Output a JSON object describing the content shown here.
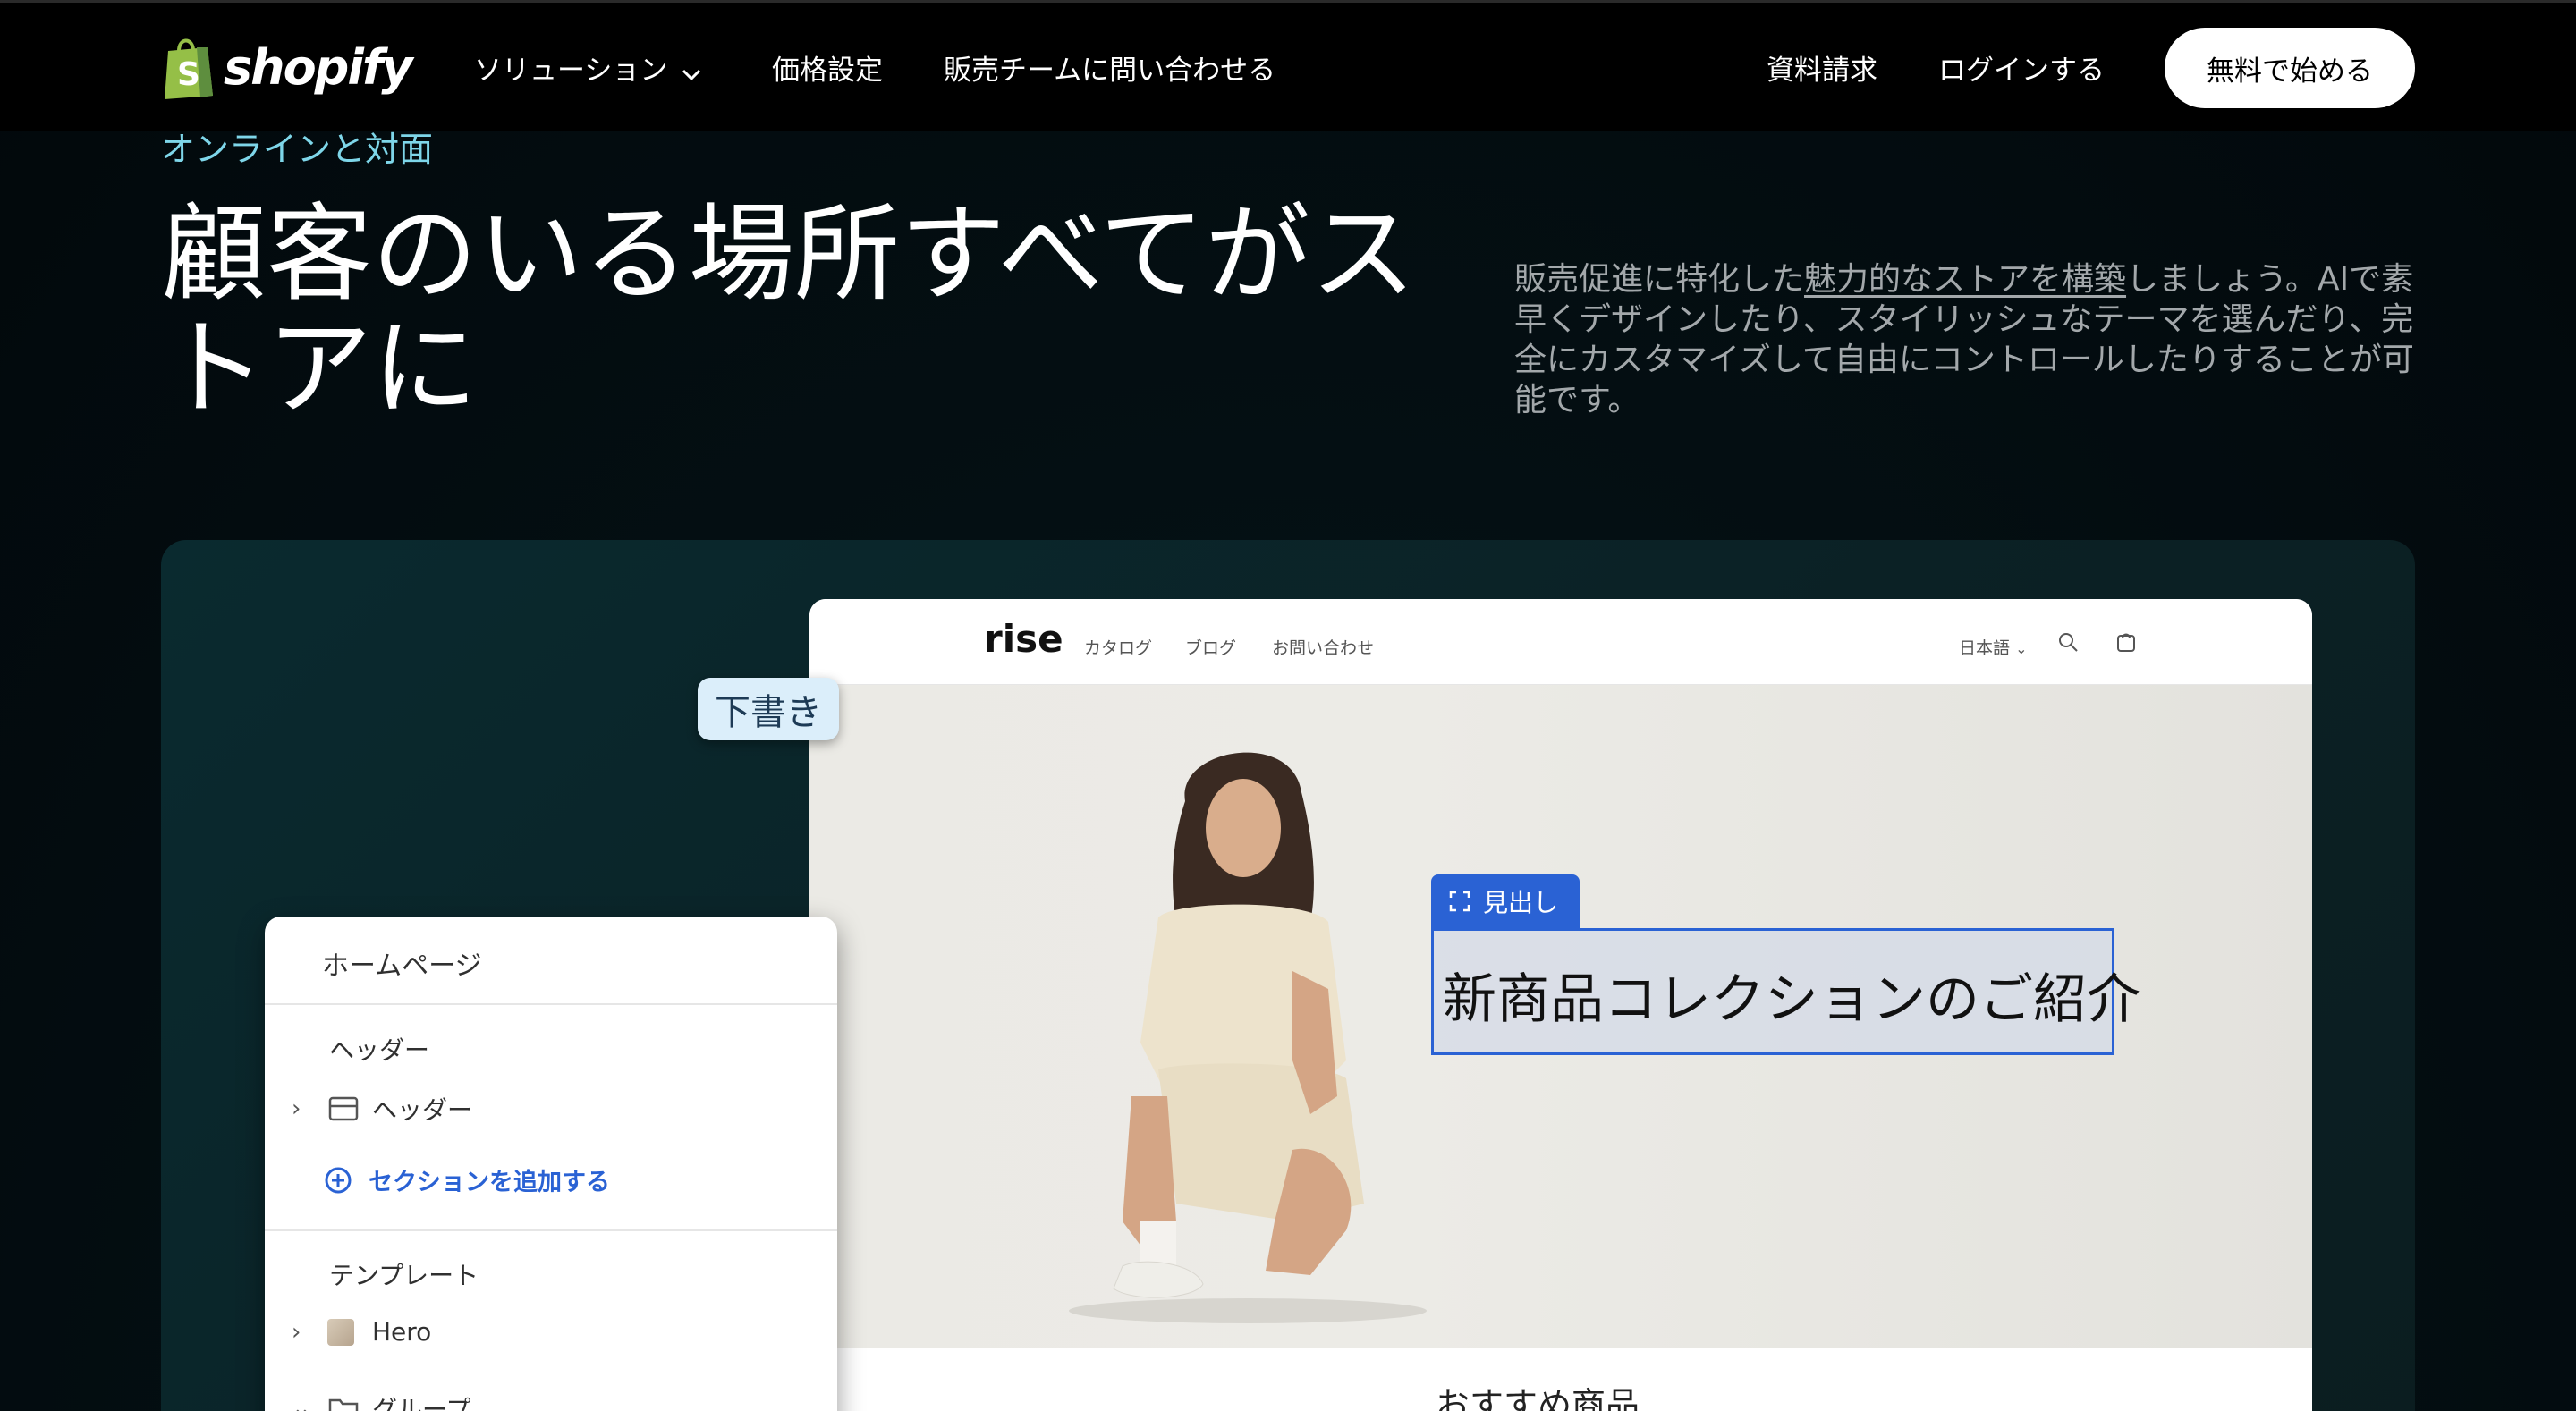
{
  "nav": {
    "logo_text": "shopify",
    "items": [
      "ソリューション",
      "価格設定",
      "販売チームに問い合わせる"
    ],
    "right_links": [
      "資料請求",
      "ログインする"
    ],
    "cta": "無料で始める"
  },
  "hero": {
    "eyebrow": "オンラインと対面",
    "headline": "顧客のいる場所すべてがストアに",
    "desc_pre": "販売促進に特化した",
    "desc_link": "魅力的なストアを構築",
    "desc_post": "しましょう。AIで素早くデザインしたり、スタイリッシュなテーマを選んだり、完全にカスタマイズして自由にコントロールしたりすることが可能です。"
  },
  "store": {
    "logo": "rise",
    "links": [
      "カタログ",
      "ブログ",
      "お問い合わせ"
    ],
    "lang": "日本語",
    "bottom_text": "おすすめ商品"
  },
  "overlay": {
    "draft": "下書き",
    "badge": "見出し",
    "heading": "新商品コレクションのご紹介"
  },
  "editor": {
    "title": "ホームページ",
    "header_section": "ヘッダー",
    "header_item": "ヘッダー",
    "add_section": "セクションを追加する",
    "template_section": "テンプレート",
    "hero_item": "Hero",
    "group_item": "グループ"
  },
  "colors": {
    "accent": "#2a62d4",
    "eyebrow": "#7ed6e9",
    "shopify_green": "#95bf47"
  }
}
